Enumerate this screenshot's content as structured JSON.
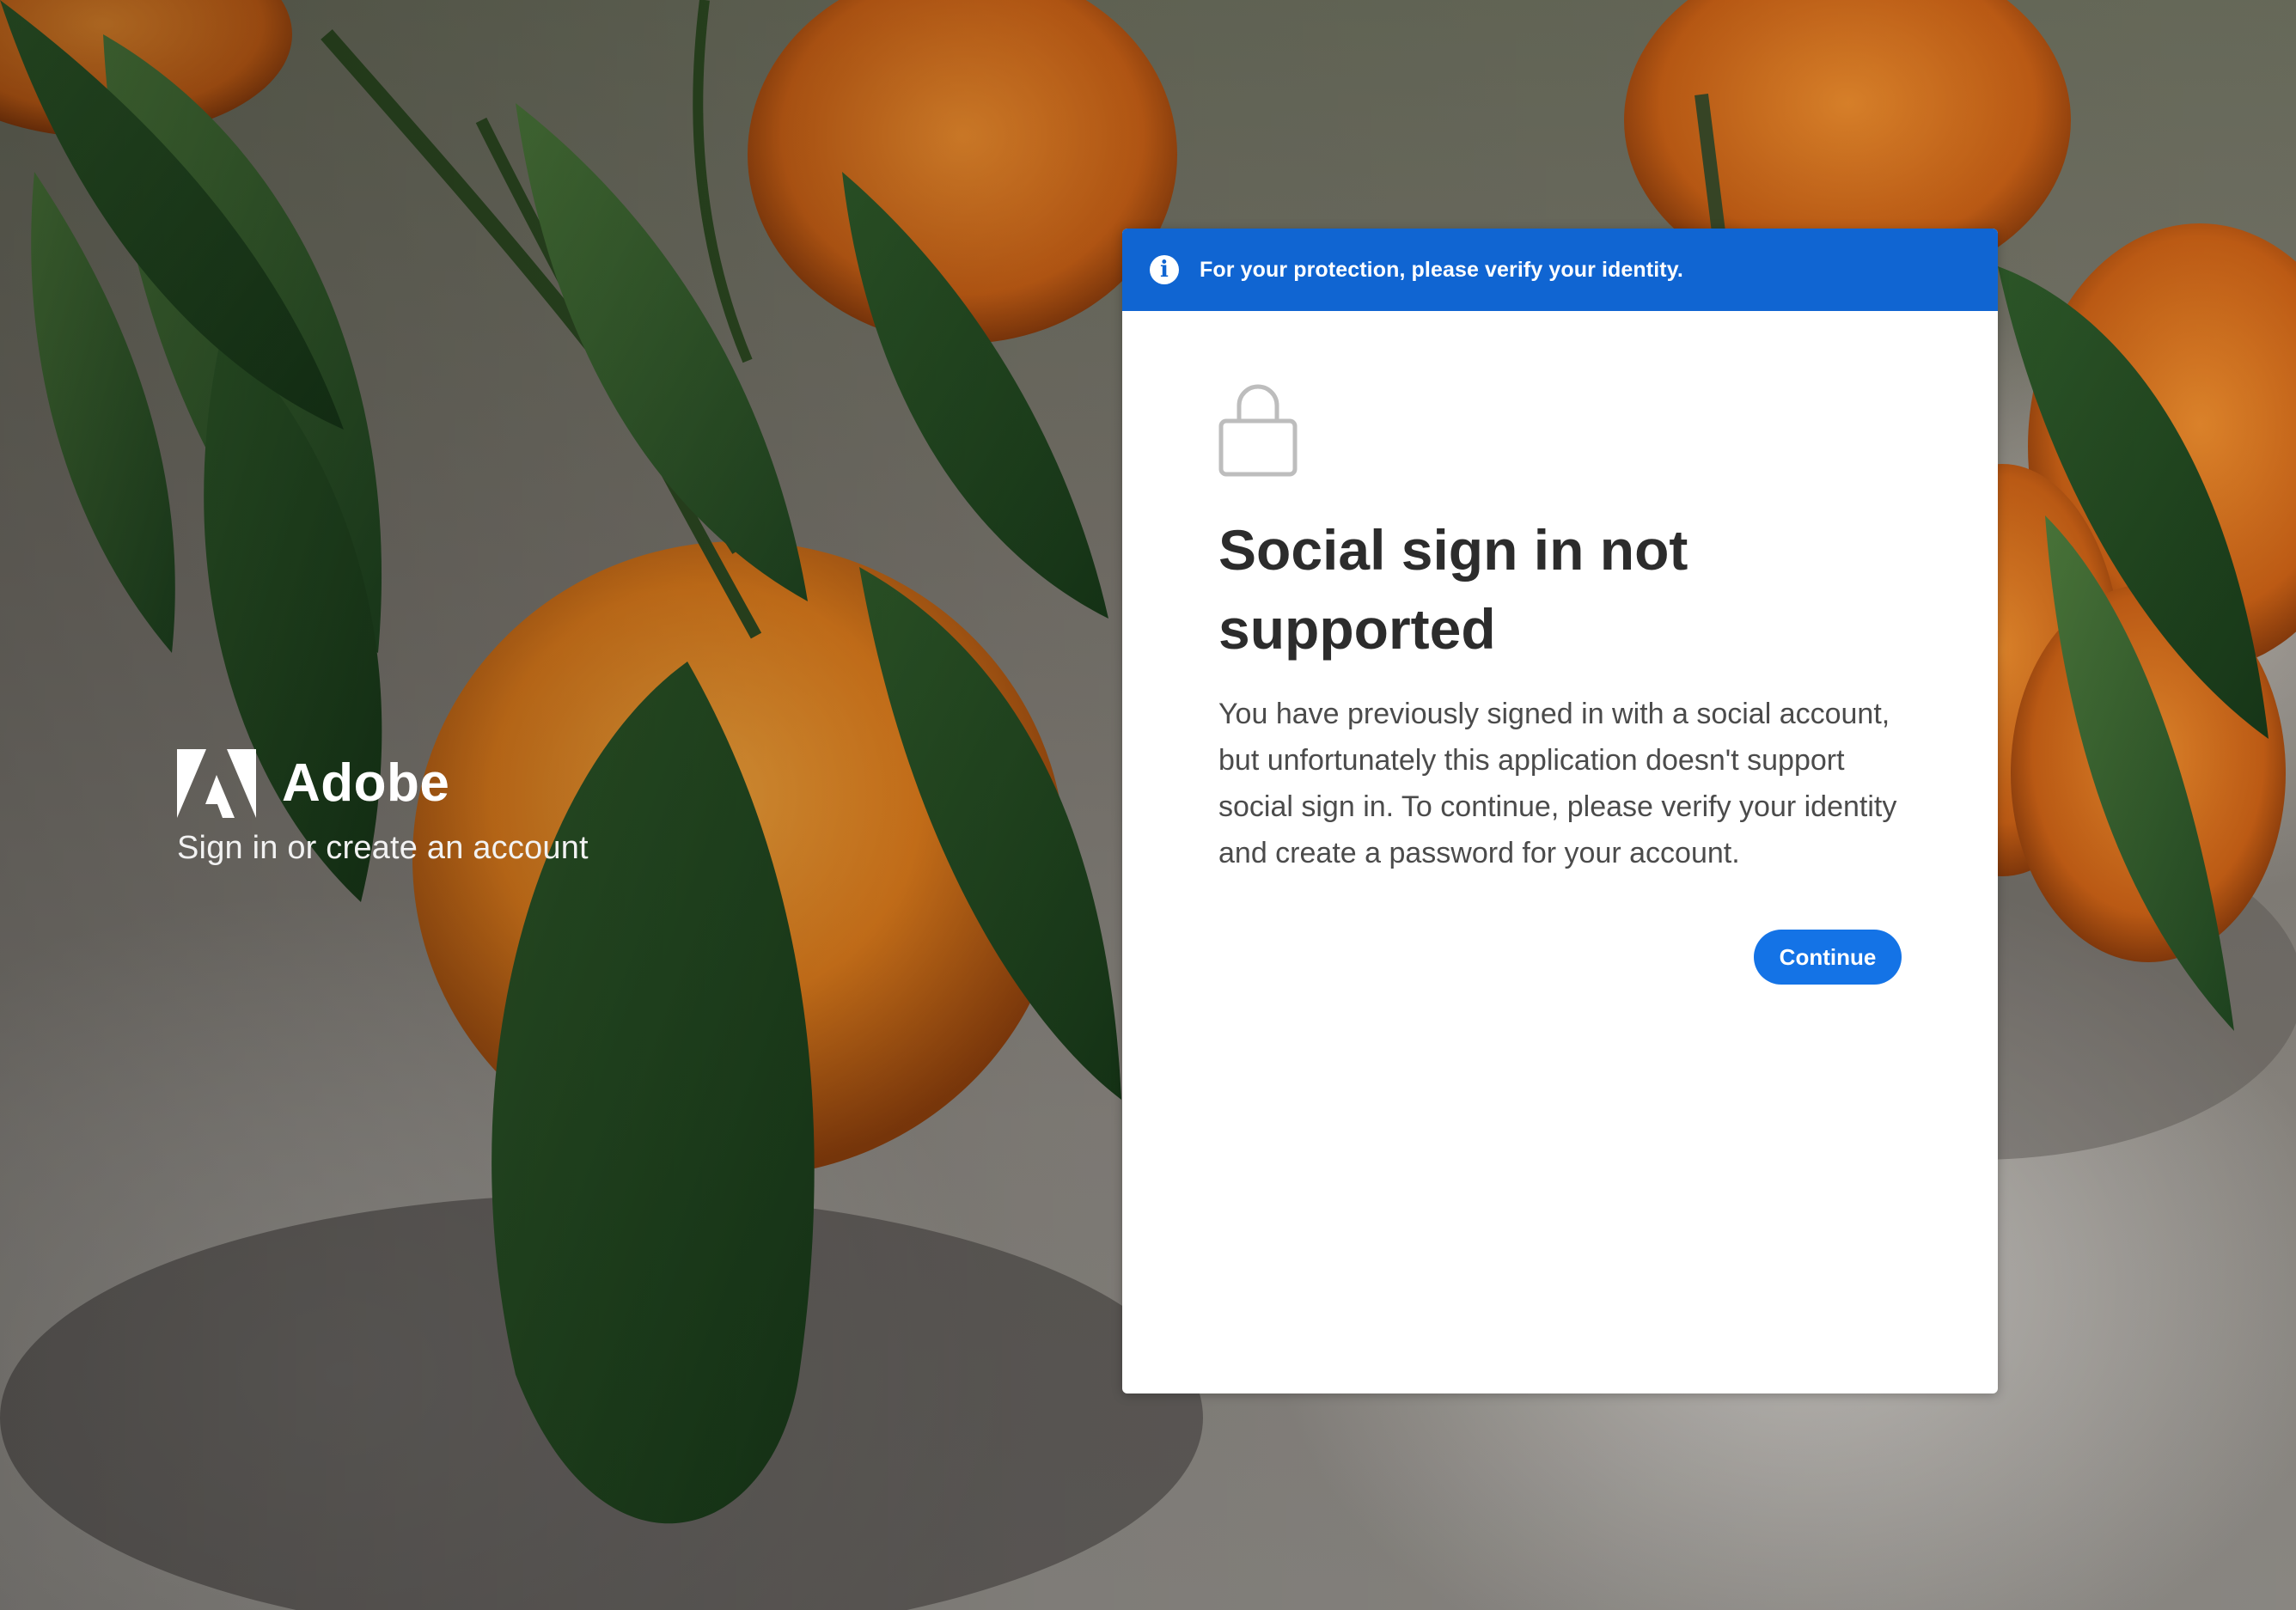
{
  "brand": {
    "name": "Adobe",
    "tagline": "Sign in or create an account",
    "logo_icon": "adobe-logo-icon"
  },
  "banner": {
    "icon": "info-icon",
    "message": "For your protection, please verify your identity.",
    "color": "#1065d2"
  },
  "card": {
    "icon": "lock-icon",
    "title": "Social sign in not supported",
    "description": "You have previously signed in with a social account, but unfortunately this application doesn't support social sign in. To continue, please verify your identity and create a password for your account.",
    "continue_label": "Continue",
    "accent_color": "#1473e6"
  }
}
